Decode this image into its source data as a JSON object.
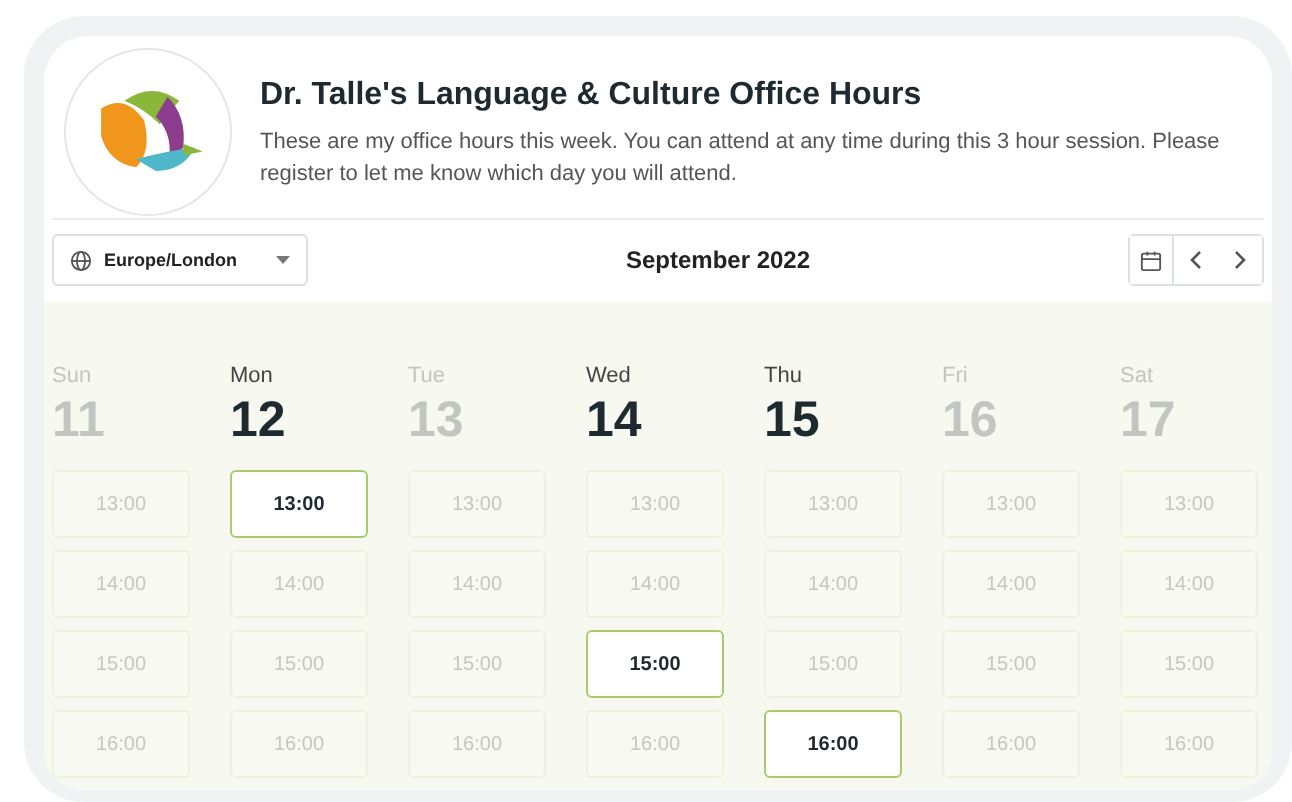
{
  "header": {
    "title": "Dr. Talle's Language & Culture Office Hours",
    "description": "These are my office hours this week. You can attend at any time during this 3 hour session. Please register to let me know which day you will attend."
  },
  "toolbar": {
    "timezone": "Europe/London",
    "month": "September 2022"
  },
  "days": [
    {
      "weekday": "Sun",
      "date": "11",
      "available": false,
      "slots": [
        {
          "time": "13:00",
          "available": false
        },
        {
          "time": "14:00",
          "available": false
        },
        {
          "time": "15:00",
          "available": false
        },
        {
          "time": "16:00",
          "available": false
        }
      ]
    },
    {
      "weekday": "Mon",
      "date": "12",
      "available": true,
      "slots": [
        {
          "time": "13:00",
          "available": true
        },
        {
          "time": "14:00",
          "available": false
        },
        {
          "time": "15:00",
          "available": false
        },
        {
          "time": "16:00",
          "available": false
        }
      ]
    },
    {
      "weekday": "Tue",
      "date": "13",
      "available": false,
      "slots": [
        {
          "time": "13:00",
          "available": false
        },
        {
          "time": "14:00",
          "available": false
        },
        {
          "time": "15:00",
          "available": false
        },
        {
          "time": "16:00",
          "available": false
        }
      ]
    },
    {
      "weekday": "Wed",
      "date": "14",
      "available": true,
      "slots": [
        {
          "time": "13:00",
          "available": false
        },
        {
          "time": "14:00",
          "available": false
        },
        {
          "time": "15:00",
          "available": true
        },
        {
          "time": "16:00",
          "available": false
        }
      ]
    },
    {
      "weekday": "Thu",
      "date": "15",
      "available": true,
      "slots": [
        {
          "time": "13:00",
          "available": false
        },
        {
          "time": "14:00",
          "available": false
        },
        {
          "time": "15:00",
          "available": false
        },
        {
          "time": "16:00",
          "available": true
        }
      ]
    },
    {
      "weekday": "Fri",
      "date": "16",
      "available": false,
      "slots": [
        {
          "time": "13:00",
          "available": false
        },
        {
          "time": "14:00",
          "available": false
        },
        {
          "time": "15:00",
          "available": false
        },
        {
          "time": "16:00",
          "available": false
        }
      ]
    },
    {
      "weekday": "Sat",
      "date": "17",
      "available": false,
      "slots": [
        {
          "time": "13:00",
          "available": false
        },
        {
          "time": "14:00",
          "available": false
        },
        {
          "time": "15:00",
          "available": false
        },
        {
          "time": "16:00",
          "available": false
        }
      ]
    }
  ]
}
